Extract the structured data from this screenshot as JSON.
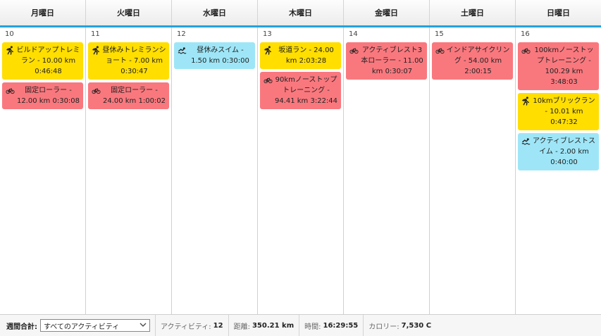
{
  "header": {
    "days": [
      "月曜日",
      "火曜日",
      "水曜日",
      "木曜日",
      "金曜日",
      "土曜日",
      "日曜日"
    ]
  },
  "days": [
    {
      "date": "10",
      "events": [
        {
          "sport": "run",
          "icon": "running-icon",
          "text": "ビルドアップトレミラン - 10.00 km 0:46:48"
        },
        {
          "sport": "bike",
          "icon": "bike-icon",
          "text": "固定ローラー - 12.00 km 0:30:08"
        }
      ]
    },
    {
      "date": "11",
      "events": [
        {
          "sport": "run",
          "icon": "running-icon",
          "text": "昼休みトレミランショート - 7.00 km 0:30:47"
        },
        {
          "sport": "bike",
          "icon": "bike-icon",
          "text": "固定ローラー - 24.00 km 1:00:02"
        }
      ]
    },
    {
      "date": "12",
      "events": [
        {
          "sport": "swim",
          "icon": "swim-icon",
          "text": "昼休みスイム - 1.50 km 0:30:00"
        }
      ]
    },
    {
      "date": "13",
      "events": [
        {
          "sport": "run",
          "icon": "running-icon",
          "text": "坂道ラン - 24.00 km 2:03:28"
        },
        {
          "sport": "bike",
          "icon": "bike-icon",
          "text": "90kmノーストップトレーニング - 94.41 km 3:22:44"
        }
      ]
    },
    {
      "date": "14",
      "events": [
        {
          "sport": "bike",
          "icon": "bike-icon",
          "text": "アクティブレスト3本ローラー - 11.00 km 0:30:07"
        }
      ]
    },
    {
      "date": "15",
      "events": [
        {
          "sport": "bike",
          "icon": "bike-icon",
          "text": "インドアサイクリング - 54.00 km 2:00:15"
        }
      ]
    },
    {
      "date": "16",
      "events": [
        {
          "sport": "bike",
          "icon": "bike-icon",
          "text": "100kmノーストップトレーニング - 100.29 km 3:48:03"
        },
        {
          "sport": "run",
          "icon": "running-icon",
          "text": "10kmブリックラン - 10.01 km 0:47:32"
        },
        {
          "sport": "swim",
          "icon": "swim-icon",
          "text": "アクティブレストスイム - 2.00 km 0:40:00"
        }
      ]
    }
  ],
  "footer": {
    "weekly_label": "週間合計:",
    "filter_value": "すべてのアクティビティ",
    "activities_label": "アクティビティ:",
    "activities_value": "12",
    "distance_label": "距離:",
    "distance_value": "350.21 km",
    "time_label": "時間:",
    "time_value": "16:29:55",
    "calories_label": "カロリー:",
    "calories_value": "7,530 C"
  },
  "colors": {
    "run": "#ffde00",
    "bike": "#f9787e",
    "swim": "#9ee6f7",
    "accent": "#23a2dd"
  }
}
